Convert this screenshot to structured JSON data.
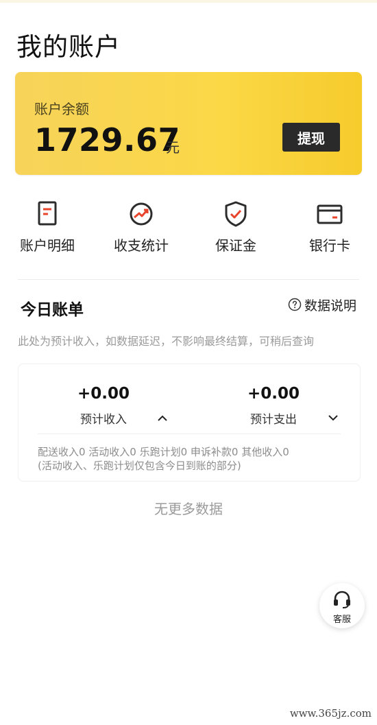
{
  "header": {
    "title": "我的账户"
  },
  "balance": {
    "label": "账户余额",
    "amount": "1729.67",
    "unit": "元",
    "withdraw_label": "提现",
    "colors": {
      "card_start": "#f7d35a",
      "card_end": "#f6cb2c",
      "button": "#2a2a2a"
    }
  },
  "quick_nav": [
    {
      "label": "账户明细",
      "icon": "document-icon"
    },
    {
      "label": "收支统计",
      "icon": "trend-chart-icon"
    },
    {
      "label": "保证金",
      "icon": "shield-check-icon"
    },
    {
      "label": "银行卡",
      "icon": "bank-card-icon"
    }
  ],
  "today_bill": {
    "title": "今日账单",
    "data_note_label": "数据说明",
    "hint": "此处为预计收入，如数据延迟，不影响最终结算，可稍后查询",
    "income": {
      "value": "+0.00",
      "label": "预计收入"
    },
    "expense": {
      "value": "+0.00",
      "label": "预计支出"
    },
    "breakdown_line1": "配送收入0 活动收入0 乐跑计划0 申诉补款0 其他收入0",
    "breakdown_line2": "(活动收入、乐跑计划仅包含今日到账的部分)"
  },
  "footer": {
    "no_more": "无更多数据"
  },
  "customer_service": {
    "label": "客服",
    "icon": "headset-icon"
  },
  "watermark": "www.365jz.com",
  "accent_color": "#e8442c"
}
